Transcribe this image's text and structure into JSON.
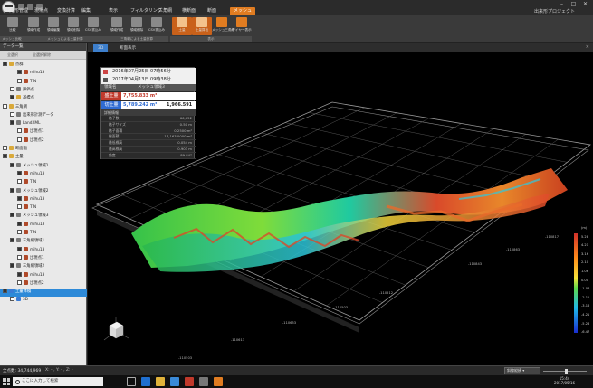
{
  "menubar": {
    "tabs": [
      "出来形管理",
      "現場点",
      "変換計算",
      "編集",
      "表示",
      "フィルタリング",
      "三角網",
      "横断面",
      "断面",
      "メッシュ"
    ],
    "active_tab_index": 9,
    "project_name": "出来形プロジェクト",
    "window_buttons": [
      "–",
      "□",
      "✕"
    ]
  },
  "ribbon": {
    "buttons": [
      {
        "label": "比較"
      },
      {
        "label": "領域作成"
      },
      {
        "label": "領域編集"
      },
      {
        "label": "領域削除"
      },
      {
        "label": "CSV書込み"
      },
      {
        "label": "領域作成"
      },
      {
        "label": "領域削除"
      },
      {
        "label": "CSV書込み"
      },
      {
        "label": "土量"
      },
      {
        "label": "土量算出"
      },
      {
        "label": "メッシュ三角網"
      },
      {
        "label": "ワイヤー表示"
      }
    ],
    "active_buttons": [
      8,
      9
    ],
    "groups": [
      "メッシュ比較",
      "メッシュによる土量計算",
      "三角網による土量計算",
      "表示"
    ]
  },
  "left_panel": {
    "title": "データ一覧",
    "toolbar": [
      "全選択",
      "全選択解除"
    ],
    "tree": [
      {
        "label": "点群",
        "indent": 0,
        "icon": "folder",
        "checked": true
      },
      {
        "label": "mihu13",
        "indent": 2,
        "icon": "red",
        "checked": true
      },
      {
        "label": "TIN",
        "indent": 2,
        "icon": "red",
        "checked": false
      },
      {
        "label": "評価点",
        "indent": 1,
        "icon": "gray",
        "checked": false
      },
      {
        "label": "基標点",
        "indent": 1,
        "icon": "folder",
        "checked": true
      },
      {
        "label": "三角網",
        "indent": 0,
        "icon": "folder",
        "checked": false
      },
      {
        "label": "出来形計測データ",
        "indent": 1,
        "icon": "gray",
        "checked": false
      },
      {
        "label": "LandXML",
        "indent": 1,
        "icon": "gray",
        "checked": true
      },
      {
        "label": "出現点1",
        "indent": 2,
        "icon": "red",
        "checked": false
      },
      {
        "label": "出現点2",
        "indent": 2,
        "icon": "red",
        "checked": false
      },
      {
        "label": "断面面",
        "indent": 0,
        "icon": "folder",
        "checked": false
      },
      {
        "label": "土量",
        "indent": 0,
        "icon": "folder",
        "checked": true
      },
      {
        "label": "メッシュ領域1",
        "indent": 1,
        "icon": "gray",
        "checked": true
      },
      {
        "label": "mihu13",
        "indent": 2,
        "icon": "red",
        "checked": true
      },
      {
        "label": "TIN",
        "indent": 2,
        "icon": "red",
        "checked": false
      },
      {
        "label": "メッシュ領域2",
        "indent": 1,
        "icon": "gray",
        "checked": true
      },
      {
        "label": "mihu13",
        "indent": 2,
        "icon": "red",
        "checked": true
      },
      {
        "label": "TIN",
        "indent": 2,
        "icon": "red",
        "checked": false
      },
      {
        "label": "メッシュ領域3",
        "indent": 1,
        "icon": "gray",
        "checked": true
      },
      {
        "label": "mihu13",
        "indent": 2,
        "icon": "red",
        "checked": true
      },
      {
        "label": "TIN",
        "indent": 2,
        "icon": "red",
        "checked": false
      },
      {
        "label": "三角網領域1",
        "indent": 1,
        "icon": "gray",
        "checked": true
      },
      {
        "label": "mihu13",
        "indent": 2,
        "icon": "red",
        "checked": true
      },
      {
        "label": "出現点1",
        "indent": 2,
        "icon": "red",
        "checked": false
      },
      {
        "label": "三角網領域2",
        "indent": 1,
        "icon": "gray",
        "checked": true
      },
      {
        "label": "mihu13",
        "indent": 2,
        "icon": "red",
        "checked": true
      },
      {
        "label": "出現点2",
        "indent": 2,
        "icon": "red",
        "checked": false
      },
      {
        "label": "土量体積",
        "indent": 0,
        "icon": "blue",
        "checked": true,
        "selected": true
      },
      {
        "label": "3D",
        "indent": 1,
        "icon": "blue",
        "checked": false
      }
    ]
  },
  "view": {
    "tabs": [
      "3D",
      "断面表示"
    ],
    "active_tab": 0,
    "close": "×"
  },
  "info_panel": {
    "date1": "2016年07月25日 07時56分",
    "date2": "2017年04月13日 09時38分",
    "section_label": "領域名",
    "section_name": "メッシュ領域3",
    "cut_label": "盛土量",
    "cut_value": "7,755.833 m³",
    "fill_label": "切土量",
    "fill_value": "5,789.242 m³",
    "extra_value": "1,966.591 m³",
    "detail_title": "詳細情報",
    "details": [
      {
        "k": "格子数",
        "v": "66,652"
      },
      {
        "k": "格子サイズ",
        "v": "0.50 m"
      },
      {
        "k": "格子面積",
        "v": "0.2500 m²"
      },
      {
        "k": "総面積",
        "v": "17,163.0000 m²"
      },
      {
        "k": "最低標高",
        "v": "-0.054 m"
      },
      {
        "k": "最高標高",
        "v": "0.903 m"
      },
      {
        "k": "角度",
        "v": "89.84°"
      }
    ]
  },
  "legend": {
    "labels": [
      "(m)",
      "5.28",
      "4.21",
      "3.16",
      "2.10",
      "1.06",
      "0.00",
      "-1.06",
      "-2.11",
      "-3.16",
      "-4.21",
      "-5.28",
      "-6.47"
    ]
  },
  "axis_labels": [
    "-110817",
    "-110863",
    "-110843",
    "-110512",
    "-110503",
    "-110653",
    "-110613",
    "-110503"
  ],
  "status": {
    "count": "全点数: 34,744,969",
    "coords": "X: - , Y: - , Z: -",
    "view_select": "斜線縦横 ▾"
  },
  "taskbar": {
    "search_placeholder": "ここに入力して検索",
    "time": "15:44",
    "date": "2017/05/16"
  },
  "colors": {
    "accent": "#e07c21",
    "cut_color": "#c0392b",
    "fill_color": "#2f6bd1",
    "selection": "#2e8ad8"
  }
}
